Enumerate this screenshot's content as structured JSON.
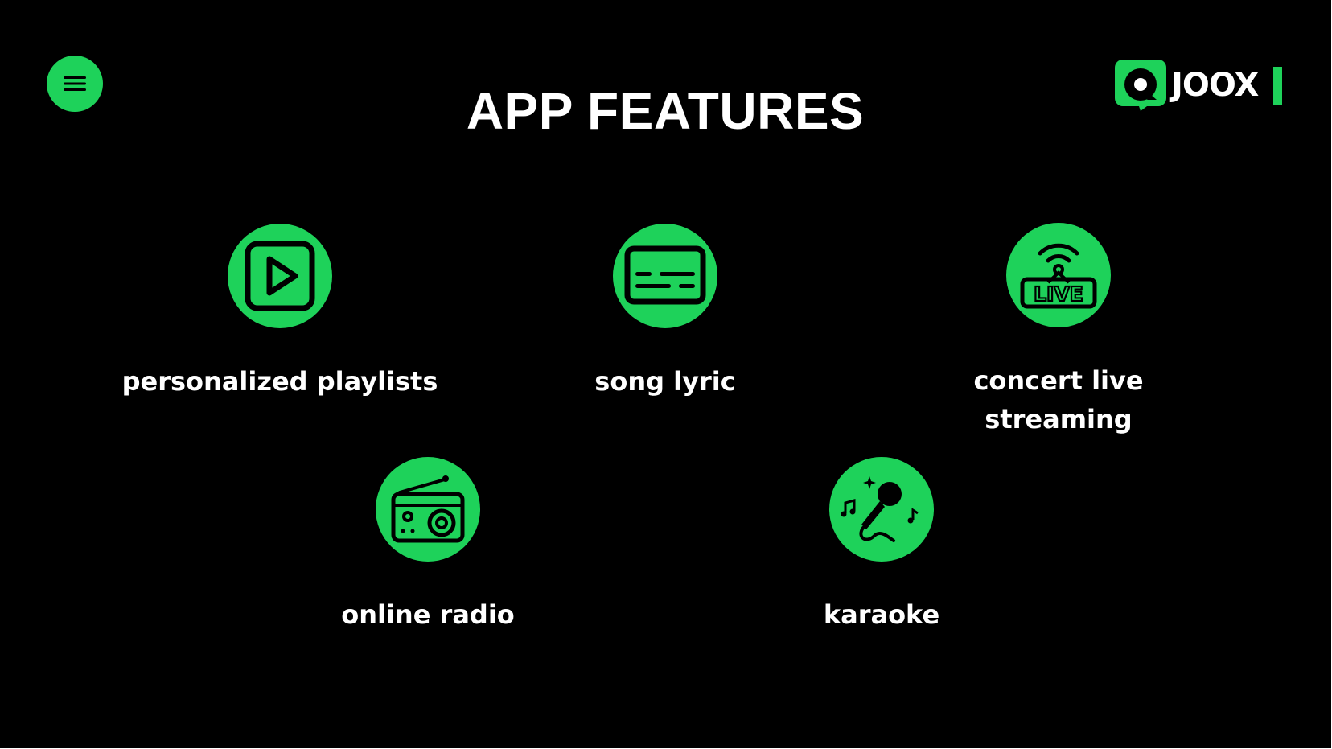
{
  "page": {
    "title": "APP FEATURES"
  },
  "header": {
    "menu_icon": "hamburger-menu-icon",
    "logo_text": "JOOX",
    "logo_icon": "joox-logo-icon"
  },
  "features": [
    {
      "label": "personalized playlists",
      "icon": "play-button-icon"
    },
    {
      "label": "song lyric",
      "icon": "subtitles-icon"
    },
    {
      "label": "concert live streaming",
      "icon": "live-broadcast-icon"
    },
    {
      "label": "online radio",
      "icon": "radio-icon"
    },
    {
      "label": "karaoke",
      "icon": "microphone-icon"
    }
  ],
  "colors": {
    "accent": "#1ed25a",
    "background": "#000000",
    "text": "#ffffff"
  }
}
